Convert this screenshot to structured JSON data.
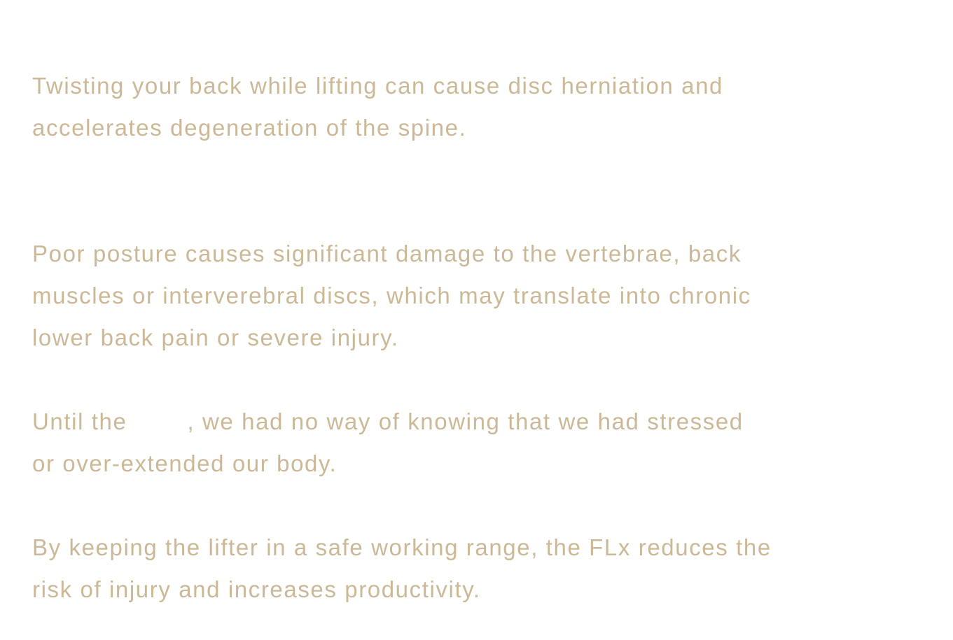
{
  "colors": {
    "text": "#cbb896",
    "background": "#ffffff"
  },
  "paragraphs": {
    "twisting": {
      "line1": "Twisting your back while lifting can cause disc herniation and",
      "line2": "accelerates degeneration of the spine."
    },
    "posture": {
      "line1": "Poor posture causes significant damage to the vertebrae, back",
      "line2": "muscles or interverebral discs, which may translate into chronic",
      "line3": "lower back pain or severe injury."
    },
    "until": {
      "line1_start": "Until the",
      "line1_end": ", we had no way of knowing that we had stressed",
      "line2": "or over-extended our body."
    },
    "keeping": {
      "line1": "By keeping the lifter in a safe working range, the FLx reduces the",
      "line2": "risk of injury and increases productivity."
    }
  }
}
